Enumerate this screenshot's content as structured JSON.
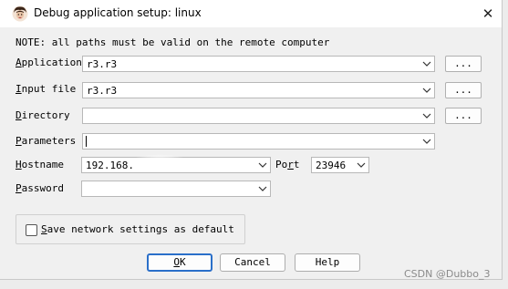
{
  "window": {
    "title": "Debug application setup: linux",
    "close_glyph": "✕"
  },
  "note": "NOTE: all paths must be valid on the remote computer",
  "fields": {
    "application": {
      "label_key": "A",
      "label_rest": "pplication",
      "value": "r3.r3"
    },
    "input_file": {
      "label_key": "I",
      "label_rest": "nput file",
      "value": "r3.r3"
    },
    "directory": {
      "label_key": "D",
      "label_rest": "irectory",
      "value": ""
    },
    "parameters": {
      "label_key": "P",
      "label_rest": "arameters",
      "value": ""
    },
    "hostname": {
      "label_key": "H",
      "label_rest": "ostname",
      "value": "192.168."
    },
    "port": {
      "label_pre": "Po",
      "label_key": "r",
      "label_rest": "t",
      "value": "23946"
    },
    "password": {
      "label_key": "P",
      "label_rest": "assword",
      "value": ""
    }
  },
  "browse_label": "...",
  "save_settings": {
    "label_key": "S",
    "label_rest": "ave network settings as default",
    "checked": false
  },
  "buttons": {
    "ok": {
      "key": "O",
      "rest": "K"
    },
    "cancel": "Cancel",
    "help": "Help"
  },
  "watermark": "CSDN @Dubbo_3",
  "icons": {
    "app": "ida-avatar-icon",
    "close": "close-icon",
    "dropdown": "chevron-down-icon"
  },
  "colors": {
    "default_button_border": "#2a6fc9",
    "window_bg": "#f0f0f0",
    "titlebar_bg": "#ffffff"
  }
}
